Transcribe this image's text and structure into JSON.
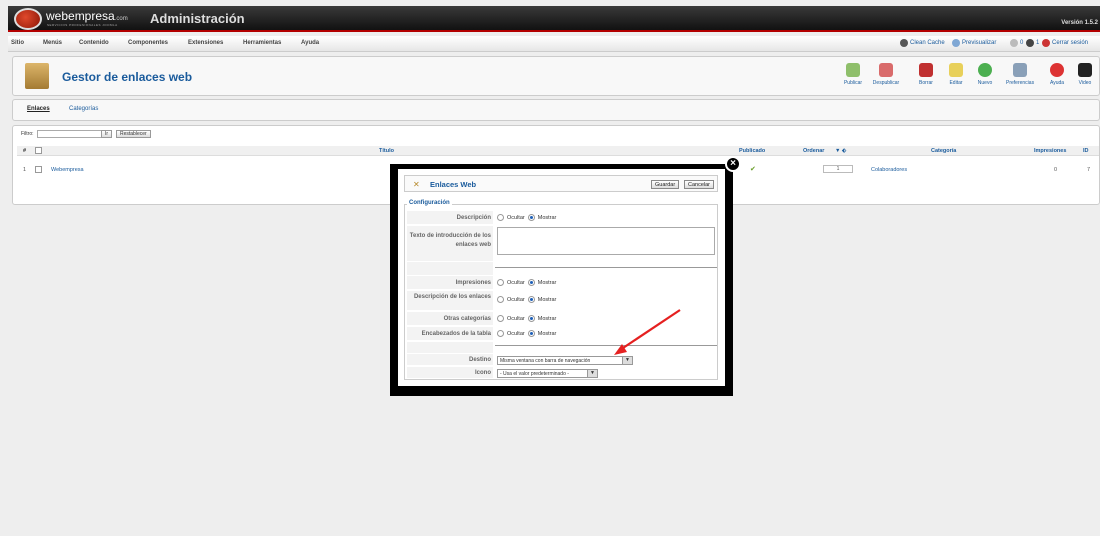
{
  "header": {
    "brand": "webempresa",
    "brand_suffix": ".com",
    "brand_tagline": "SERVICIOS PROFESIONALES JOOMLA",
    "title": "Administración",
    "version": "Versión 1.5.2"
  },
  "menu": {
    "items": [
      "Sitio",
      "Menús",
      "Contenido",
      "Componentes",
      "Extensiones",
      "Herramientas",
      "Ayuda"
    ],
    "right": {
      "clean_cache": "Clean Cache",
      "preview": "Previsualizar",
      "count_a": "0",
      "count_b": "1",
      "logout": "Cerrar sesión"
    }
  },
  "toolbar": {
    "page_title": "Gestor de enlaces web",
    "buttons": [
      "Publicar",
      "Despublicar",
      "Borrar",
      "Editar",
      "Nuevo",
      "Preferencias",
      "Ayuda",
      "Video"
    ]
  },
  "submenu": {
    "tabs": [
      "Enlaces",
      "Categorías"
    ]
  },
  "list": {
    "filter_label": "Filtro:",
    "go_label": "Ir",
    "reset_label": "Restablecer",
    "columns": {
      "num": "#",
      "title": "Título",
      "published": "Publicado",
      "order": "Ordenar",
      "category": "Categoría",
      "hits": "Impresiones",
      "id": "ID"
    },
    "rows": [
      {
        "num": "1",
        "title": "Webempresa",
        "published": "✔",
        "order": "1",
        "category": "Colaboradores",
        "hits": "0",
        "id": "7"
      }
    ]
  },
  "modal": {
    "title": "Enlaces Web",
    "save": "Guardar",
    "cancel": "Cancelar",
    "close": "×",
    "fieldset": "Configuración",
    "hide": "Ocultar",
    "show": "Mostrar",
    "fields": {
      "description": "Descripción",
      "intro_text": "Texto de introducción de los enlaces web",
      "hits": "Impresiones",
      "link_desc": "Descripción de los enlaces",
      "other_cats": "Otras categorías",
      "table_headers": "Encabezados de la tabla",
      "target": "Destino",
      "icon": "Icono"
    },
    "target_value": "Misma ventana con barra de navegación",
    "icon_value": "- Usa el valor predeterminado -"
  },
  "colors": {
    "accent": "#1a5b9c",
    "header_bg": "#111111",
    "header_border": "#b30000",
    "annotation_arrow": "#e52020"
  }
}
